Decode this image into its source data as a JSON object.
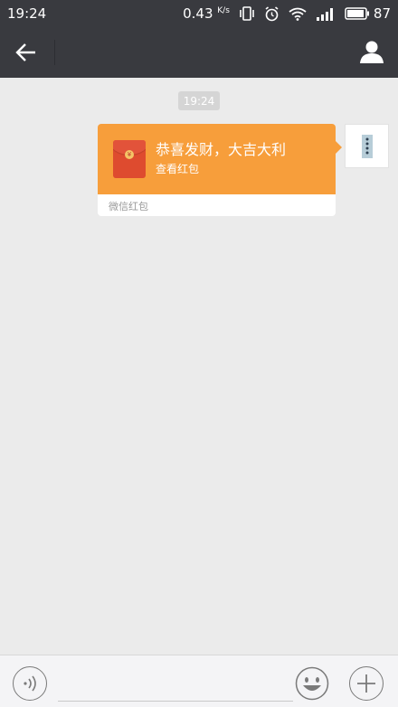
{
  "status_bar": {
    "time": "19:24",
    "speed_value": "0.43",
    "speed_unit": "K/s",
    "battery": "87"
  },
  "chat": {
    "timestamp": "19:24",
    "red_packet": {
      "title": "恭喜发财，大吉大利",
      "action": "查看红包",
      "footer": "微信红包"
    }
  },
  "colors": {
    "bar_bg": "#393a3f",
    "chat_bg": "#ebebeb",
    "packet_orange": "#f79e3b",
    "envelope_red": "#de4b2f"
  },
  "icons": {
    "back": "back-arrow-icon",
    "profile": "person-icon",
    "voice": "voice-icon",
    "emoji": "smiley-icon",
    "more": "plus-icon"
  }
}
